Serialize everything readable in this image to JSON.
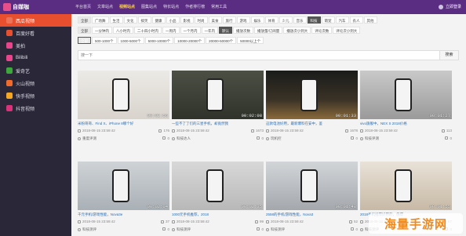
{
  "header": {
    "logo_text": "自媒咖",
    "nav": [
      "平台首页",
      "文章站点",
      "视频站点",
      "图集站点",
      "特长站点",
      "作者排行榜",
      "常用工具"
    ],
    "active_nav": 2,
    "user": "立即登录"
  },
  "sidebar": {
    "items": [
      {
        "label": "西瓜视频",
        "color": "#e84f2f"
      },
      {
        "label": "百度好看",
        "color": "#e84f2f"
      },
      {
        "label": "美拍",
        "color": "#e8458c"
      },
      {
        "label": "Bilibili",
        "color": "#e8458c"
      },
      {
        "label": "爱奇艺",
        "color": "#3ca83c"
      },
      {
        "label": "火山视频",
        "color": "#f06a2b"
      },
      {
        "label": "快手视频",
        "color": "#f5a623"
      },
      {
        "label": "抖音视频",
        "color": "#d9327b"
      }
    ],
    "active": 0
  },
  "filters": {
    "category": [
      "全部",
      "广场舞",
      "生活",
      "文化",
      "搞笑",
      "健康",
      "小品",
      "影视",
      "时尚",
      "美食",
      "旅行",
      "游戏",
      "娱乐",
      "体育",
      "少儿",
      "音乐",
      "科技",
      "萌宠",
      "汽车",
      "农人",
      "其他"
    ],
    "category_selected": 16,
    "duration": [
      "全部",
      "一分钟内",
      "八小时内",
      "二十四小时内",
      "一周内",
      "一个月内",
      "一年内",
      "默认",
      "播放次数",
      "播放量/订阅量",
      "播放次小到大",
      "评论次数",
      "评论次小到大"
    ],
    "duration_selected": 7,
    "plays": [
      "全部",
      "500-1000个",
      "1000-5000个",
      "5000-10000个",
      "10000-20000个",
      "20000-50000个",
      "50000以上个"
    ],
    "plays_selected": 0
  },
  "search": {
    "placeholder": "搜一下",
    "button": "搜索"
  },
  "videos": [
    {
      "title": "米粉哥哥、Find X、iPhone 8哪个好",
      "duration": "00:02:56",
      "date": "2018-08-15 23:59:42",
      "views": "176",
      "author": "重度评测",
      "comments": "0"
    },
    {
      "title": "一些不了了们的三星手机，却竟然我",
      "duration": "00:02:08",
      "date": "2018-08-15 23:59:42",
      "views": "1673",
      "author": "科技达人",
      "comments": "0"
    },
    {
      "title": "这款电池好用，最新爆料在安中，鉴",
      "duration": "00:01:33",
      "date": "2018-08-15 23:59:42",
      "views": "1678",
      "author": "玩机控",
      "comments": "0"
    },
    {
      "title": "vivo旗舰中，NEX S 2018价格",
      "duration": "00:01:27",
      "date": "2018-08-15 23:59:42",
      "views": "113",
      "author": "科技评测",
      "comments": "0"
    },
    {
      "title": "千元手机/游戏性能，Nova3e",
      "duration": "00:02:04",
      "date": "2018-08-15 23:59:42",
      "views": "37",
      "author": "科技测评",
      "comments": "0"
    },
    {
      "title": "1000元手机推荐，2018",
      "duration": "00:02:35",
      "date": "2018-08-15 23:59:42",
      "views": "99",
      "author": "科技测评",
      "comments": "0"
    },
    {
      "title": "2558的手机/游戏性能，Nova3",
      "duration": "00:01:48",
      "date": "2018-08-15 23:59:42",
      "views": "52",
      "author": "科技测评",
      "comments": "0"
    },
    {
      "title": "2018手机推荐好用的，值得",
      "duration": "00:01:55",
      "date": "2018-08-15 23:59:42",
      "views": "87",
      "author": "科技测评",
      "comments": "0"
    }
  ],
  "watermark": "海量手游网"
}
